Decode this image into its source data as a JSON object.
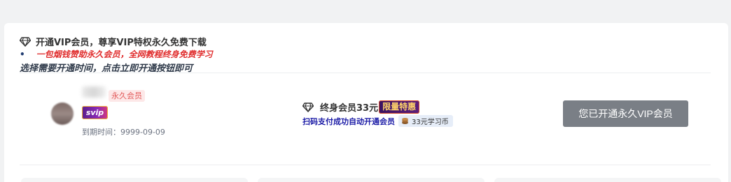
{
  "header": {
    "title": "开通VIP会员，尊享VIP特权永久免费下载",
    "bullet": "•",
    "promo_text": "一包烟钱赞助永久会员，全网教程终身免费学习",
    "instruction": "选择需要开通时间，点击立即开通按钮即可"
  },
  "user": {
    "membership_tag": "永久会员",
    "vip_badge": "svip",
    "expiry": "到期时间：9999-09-09"
  },
  "plan": {
    "title": "终身会员33元",
    "promo_badge": "限量特惠",
    "pay_note": "扫码支付成功自动开通会员",
    "coin_label": "33元学习币"
  },
  "action": {
    "button_label": "您已开通永久VIP会员"
  },
  "colors": {
    "accent_red": "#e02d2d",
    "pay_blue": "#1a1aa6",
    "button_gray": "#7a7f86",
    "svip_purple": "#8a2bb5"
  },
  "icons": {
    "diamond": "diamond-icon",
    "coin": "coin-icon"
  }
}
